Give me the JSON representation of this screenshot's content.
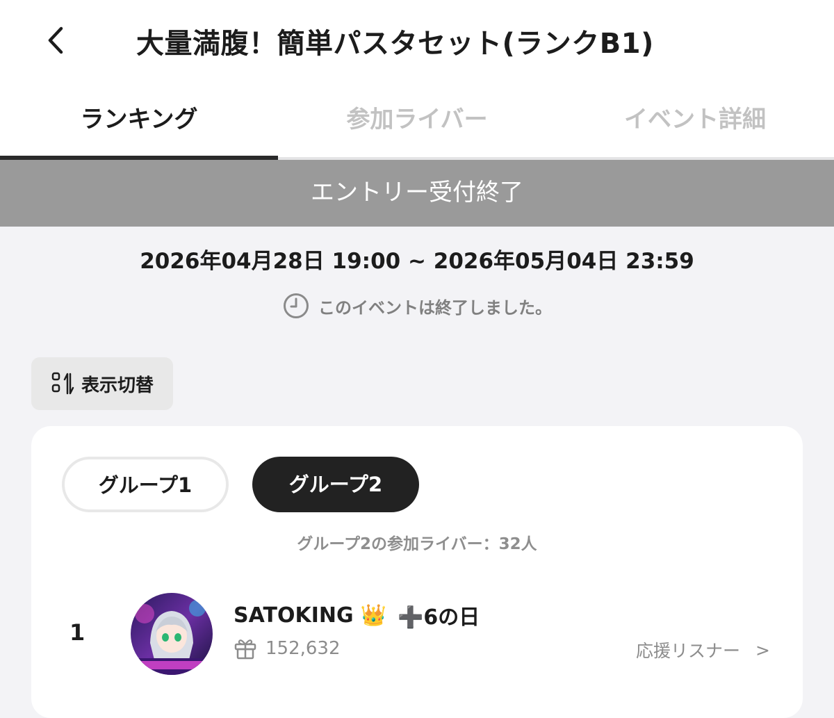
{
  "header": {
    "title": "大量満腹！簡単パスタセット(ランクB1)",
    "back_icon": "chevron-left-icon"
  },
  "tabs": [
    {
      "label": "ランキング",
      "active": true
    },
    {
      "label": "参加ライバー",
      "active": false
    },
    {
      "label": "イベント詳細",
      "active": false
    }
  ],
  "banner": {
    "text": "エントリー受付終了"
  },
  "event": {
    "period": "2026年04月28日 19:00 ~ 2026年05月04日 23:59",
    "status": "このイベントは終了しました。",
    "status_icon": "clock-icon"
  },
  "display_toggle": {
    "label": "表示切替",
    "icon": "sort-toggle-icon"
  },
  "groups": [
    {
      "label": "グループ1",
      "selected": false
    },
    {
      "label": "グループ2",
      "selected": true
    }
  ],
  "participants_text": "グループ2の参加ライバー：32人",
  "ranking": [
    {
      "rank": "1",
      "name": "SATOKING",
      "crown": "👑",
      "badge": "➕6の日",
      "gift_icon": "gift-icon",
      "points": "152,632",
      "supporters_label": "応援リスナー",
      "supporters_chevron": ">"
    }
  ],
  "colors": {
    "background": "#f3f3f6",
    "banner": "#9a9a9a",
    "active_group": "#222222",
    "muted_text": "#8c8c8c"
  }
}
